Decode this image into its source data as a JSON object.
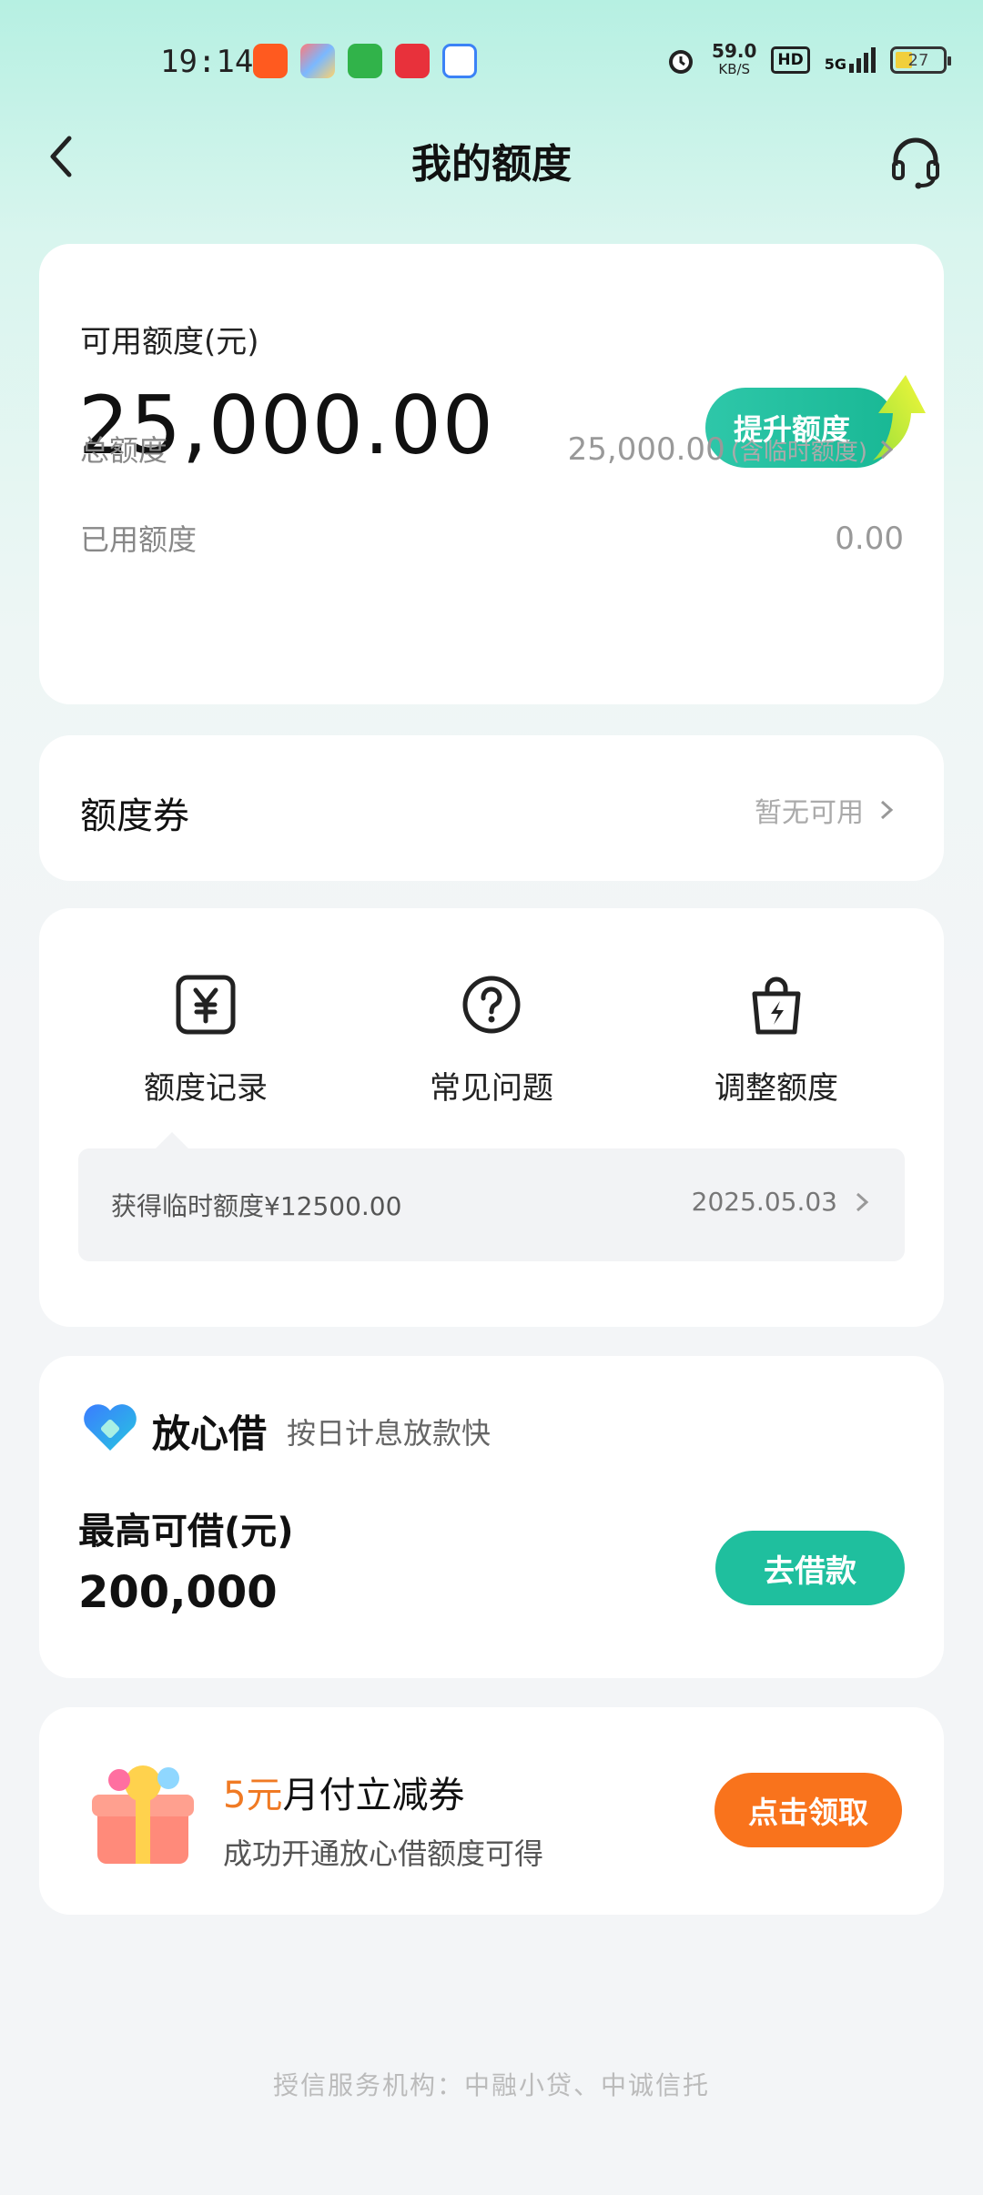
{
  "status_bar": {
    "time": "19:14",
    "net_speed": "59.0",
    "net_unit": "KB/S",
    "hd": "HD",
    "signal": "5G",
    "battery": "27"
  },
  "nav": {
    "title": "我的额度",
    "back_icon": "chevron-left-icon",
    "support_icon": "headset-icon"
  },
  "quota": {
    "available_label": "可用额度(元)",
    "available_value": "25,000.00",
    "raise_button": "提升额度",
    "total_label": "总额度",
    "total_value": "25,000.00",
    "total_note": "(含临时额度)",
    "used_label": "已用额度",
    "used_value": "0.00"
  },
  "coupon": {
    "label": "额度券",
    "value": "暂无可用"
  },
  "shortcuts": [
    {
      "label": "额度记录",
      "icon": "yen-receipt-icon"
    },
    {
      "label": "常见问题",
      "icon": "question-circle-icon"
    },
    {
      "label": "调整额度",
      "icon": "bag-lightning-icon"
    }
  ],
  "record": {
    "text": "获得临时额度¥12500.00",
    "date": "2025.05.03"
  },
  "loan": {
    "brand": "放心借",
    "slogan": "按日计息放款快",
    "max_label": "最高可借(元)",
    "max_value": "200,000",
    "button": "去借款"
  },
  "promo": {
    "highlight": "5元",
    "title_rest": "月付立减券",
    "subtitle": "成功开通放心借额度可得",
    "button": "点击领取"
  },
  "footer": "授信服务机构：中融小贷、中诚信托",
  "colors": {
    "accent_green": "#1fbf9e",
    "promo_orange": "#f9731c",
    "highlight_orange": "#f07a24"
  }
}
